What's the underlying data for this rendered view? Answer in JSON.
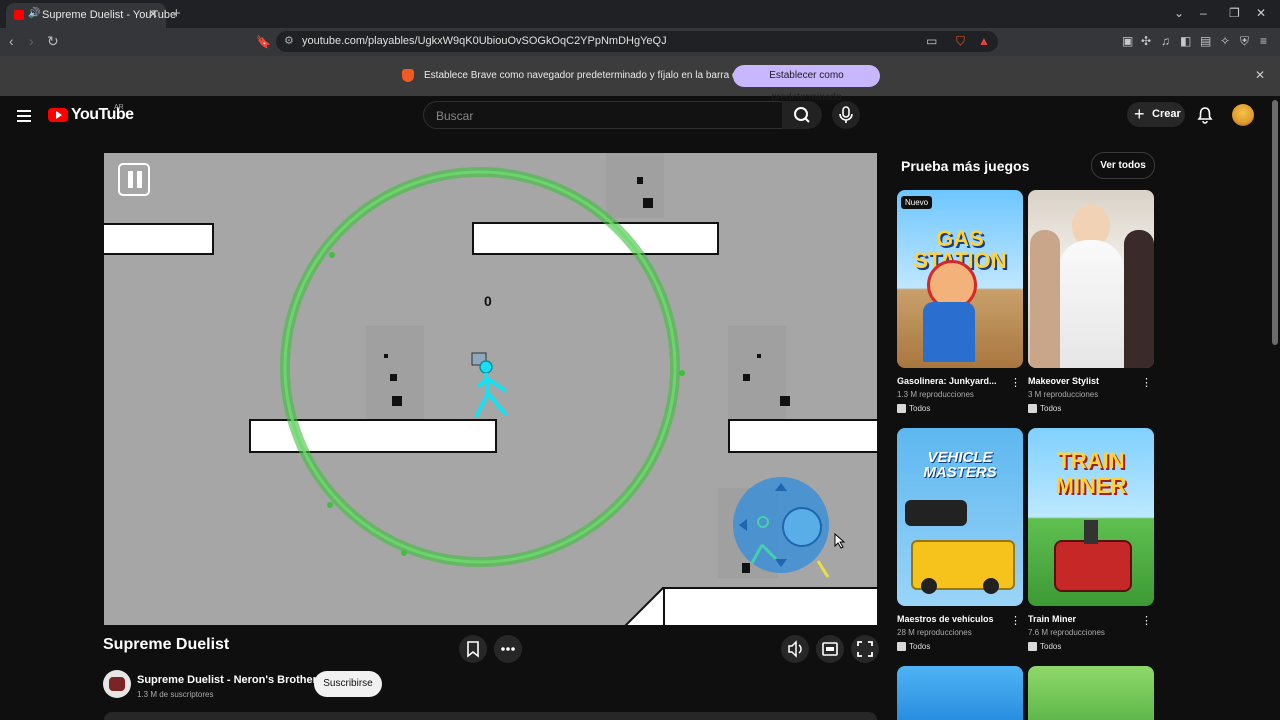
{
  "browser": {
    "tab_title": "Supreme Duelist - YouTube",
    "url": "youtube.com/playables/UgkxW9qK0UbiouOvSOGkOqC2YPpNmDHgYeQJ",
    "infobar_message": "Establece Brave como navegador predeterminado y fíjalo en la barra de tareas",
    "infobar_button": "Establecer como predeterminado"
  },
  "header": {
    "logo_text": "YouTube",
    "country_code": "AR",
    "search_placeholder": "Buscar",
    "create_label": "Crear"
  },
  "game": {
    "title": "Supreme Duelist",
    "score": "0"
  },
  "channel": {
    "name": "Supreme Duelist - Neron's Brother",
    "subscribers": "1.3 M de suscriptores",
    "subscribe_label": "Suscribirse"
  },
  "sidebar": {
    "title": "Prueba más juegos",
    "see_all": "Ver todos",
    "games": [
      {
        "name": "Gasolinera: Junkyard...",
        "views": "1.3 M reproducciones",
        "badge": "Todos",
        "tag": "Nuevo",
        "thumb_text": "GAS STATION"
      },
      {
        "name": "Makeover Stylist",
        "views": "3 M reproducciones",
        "badge": "Todos"
      },
      {
        "name": "Maestros de vehículos",
        "views": "28 M reproducciones",
        "badge": "Todos",
        "thumb_text": "VEHICLE MASTERS"
      },
      {
        "name": "Train Miner",
        "views": "7.6 M reproducciones",
        "badge": "Todos",
        "thumb_text": "TRAIN MINER"
      }
    ]
  },
  "colors": {
    "youtube_red": "#ff0000",
    "game_bg": "#a6a6a6",
    "aura_green": "#3fbf3f",
    "player_cyan": "#19e0f0",
    "joystick_blue": "#3d8fd6"
  }
}
